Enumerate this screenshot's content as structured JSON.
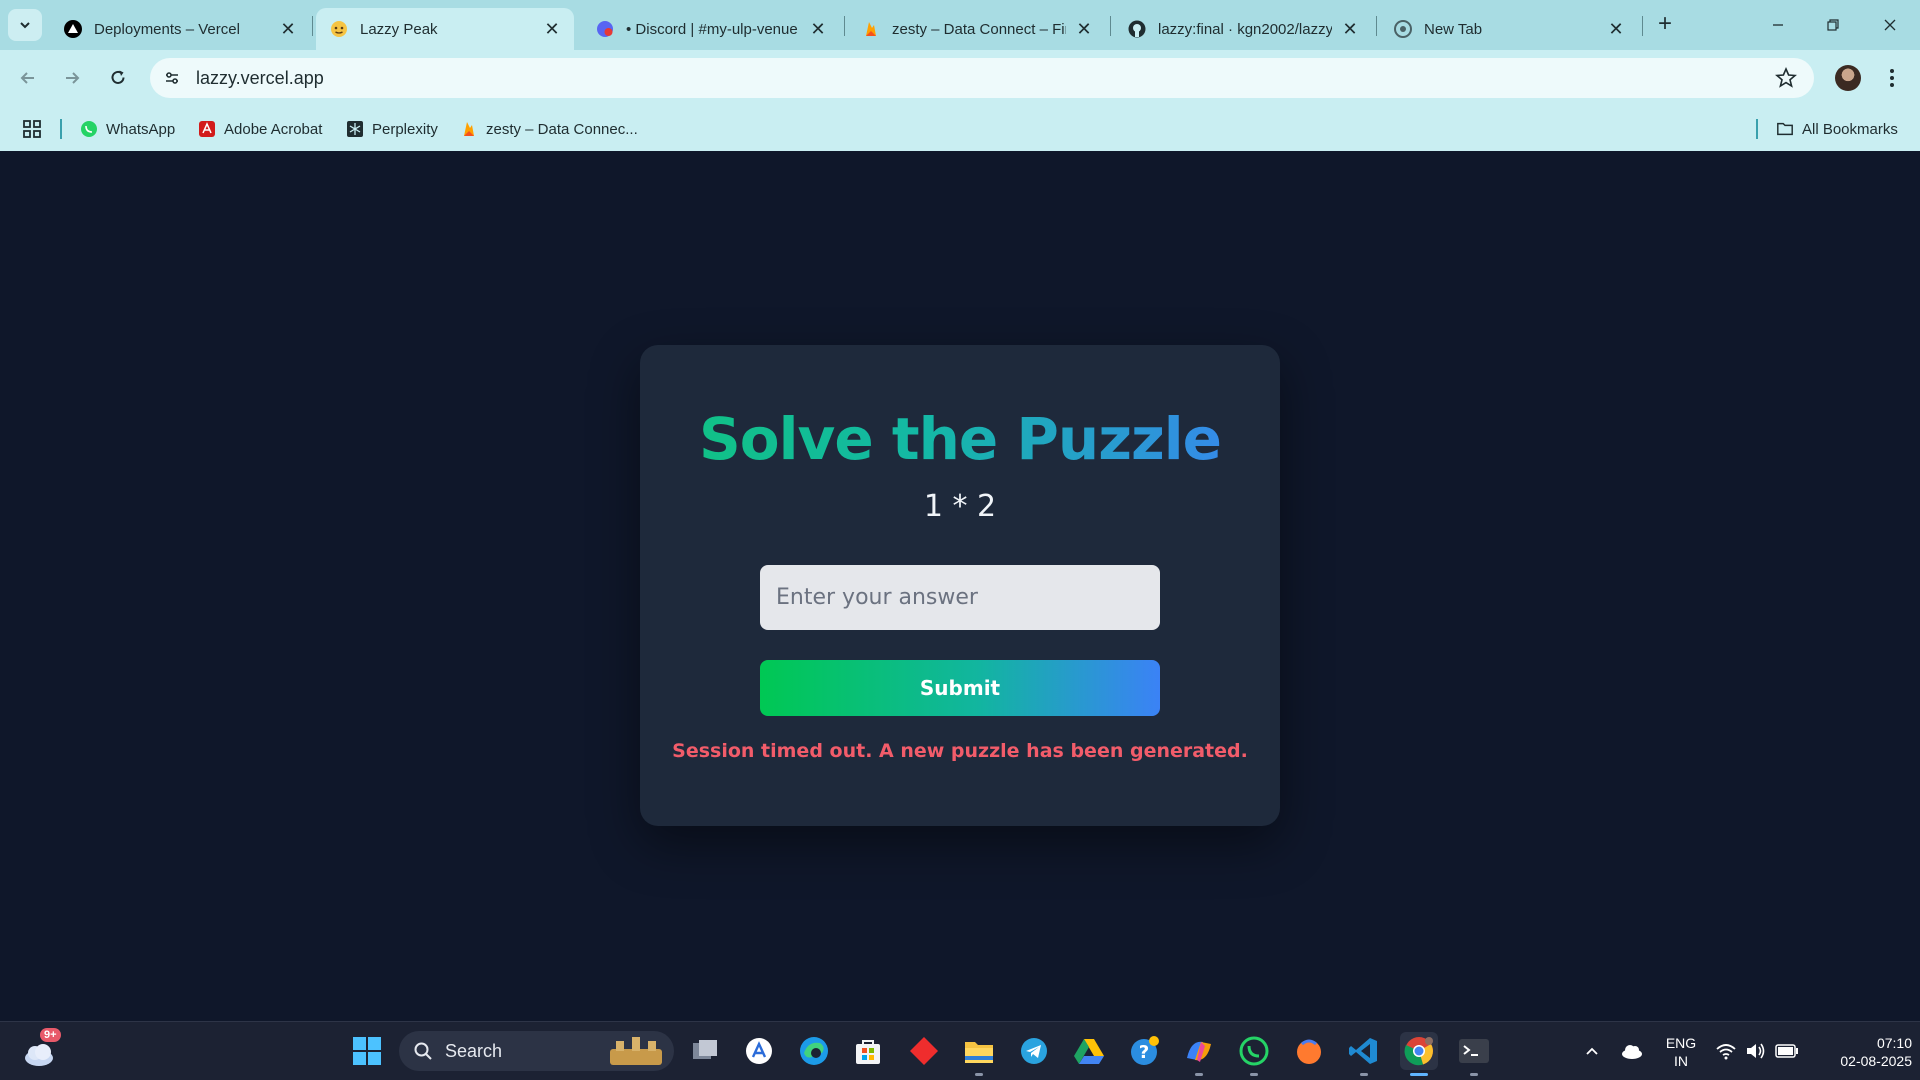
{
  "browser": {
    "tabs": [
      {
        "title": "Deployments – Vercel",
        "icon": "vercel-icon",
        "active": false
      },
      {
        "title": "Lazzy Peak",
        "icon": "emoji-favicon-icon",
        "active": true
      },
      {
        "title": "• Discord | #my-ulp-venue",
        "icon": "discord-icon",
        "active": false
      },
      {
        "title": "zesty – Data Connect – Fire",
        "icon": "firebase-icon",
        "active": false
      },
      {
        "title": "lazzy:final · kgn2002/lazzy",
        "icon": "github-icon",
        "active": false
      },
      {
        "title": "New Tab",
        "icon": "chrome-icon",
        "active": false
      }
    ],
    "url": "lazzy.vercel.app",
    "bookmarks": [
      {
        "label": "WhatsApp",
        "icon": "whatsapp-icon"
      },
      {
        "label": "Adobe Acrobat",
        "icon": "acrobat-icon"
      },
      {
        "label": "Perplexity",
        "icon": "perplexity-icon"
      },
      {
        "label": "zesty – Data Connec...",
        "icon": "firebase-icon"
      }
    ],
    "all_bookmarks_label": "All Bookmarks"
  },
  "page": {
    "heading": "Solve the Puzzle",
    "puzzle": "1 * 2",
    "answer_placeholder": "Enter your answer",
    "answer_value": "",
    "submit_label": "Submit",
    "message": "Session timed out. A new puzzle has been generated.",
    "colors": {
      "background": "#0f172a",
      "card": "#1e293b",
      "error": "#f25c6a",
      "gradient_start": "#10c37f",
      "gradient_end": "#3b82f6"
    }
  },
  "taskbar": {
    "weather_badge": "9+",
    "search_label": "Search",
    "tray": {
      "language": "ENG",
      "region": "IN",
      "time": "07:10",
      "date": "02-08-2025"
    }
  }
}
